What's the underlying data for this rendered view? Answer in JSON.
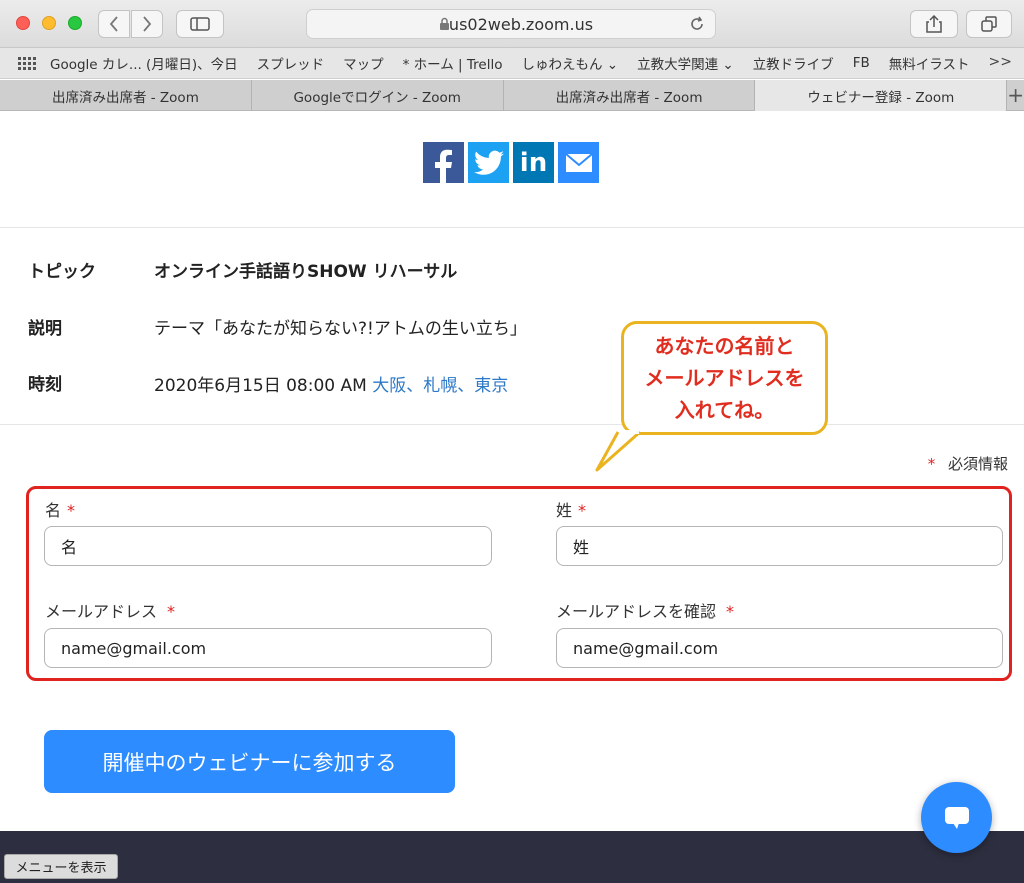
{
  "browser": {
    "url": "us02web.zoom.us",
    "bookmarks": [
      "Google カレ... (月曜日)、今日",
      "スプレッド",
      "マップ",
      "* ホーム | Trello",
      "しゅわえもん ⌄",
      "立教大学関連 ⌄",
      "立教ドライブ",
      "FB",
      "無料イラスト"
    ],
    "bookmarks_more": ">>",
    "tabs": [
      {
        "label": "出席済み出席者 - Zoom",
        "active": false
      },
      {
        "label": "Googleでログイン - Zoom",
        "active": false
      },
      {
        "label": "出席済み出席者 - Zoom",
        "active": false
      },
      {
        "label": "ウェビナー登録 - Zoom",
        "active": true
      }
    ],
    "new_tab": "+"
  },
  "share": {
    "icons": [
      "facebook-icon",
      "twitter-icon",
      "linkedin-icon",
      "email-icon"
    ],
    "colors": {
      "facebook": "#3b5998",
      "twitter": "#1da1f2",
      "linkedin": "#0077b5",
      "email": "#2d8cff"
    },
    "linkedin_text": "in"
  },
  "details": {
    "topic_label": "トピック",
    "topic_value": "オンライン手話語りSHOW リハーサル",
    "description_label": "説明",
    "description_value": "テーマ「あなたが知らない?!アトムの生い立ち」",
    "time_label": "時刻",
    "time_value": "2020年6月15日 08:00 AM",
    "time_zones": "大阪、札幌、東京"
  },
  "annotation": {
    "line1": "あなたの名前と",
    "line2": "メールアドレスを",
    "line3": "入れてね。"
  },
  "form": {
    "required_mark": "*",
    "required_note": "必須情報",
    "first_name_label": "名",
    "first_name_value": "名",
    "last_name_label": "姓",
    "last_name_value": "姓",
    "email_label": "メールアドレス",
    "email_value": "name@gmail.com",
    "email_confirm_label": "メールアドレスを確認",
    "email_confirm_value": "name@gmail.com"
  },
  "join_button": "開催中のウェビナーに参加する",
  "menu_button": "メニューを表示",
  "colors": {
    "accent": "#2d8cff",
    "highlight_red": "#e1231f",
    "bubble_border": "#e9b420",
    "footer": "#2d2e3f"
  }
}
